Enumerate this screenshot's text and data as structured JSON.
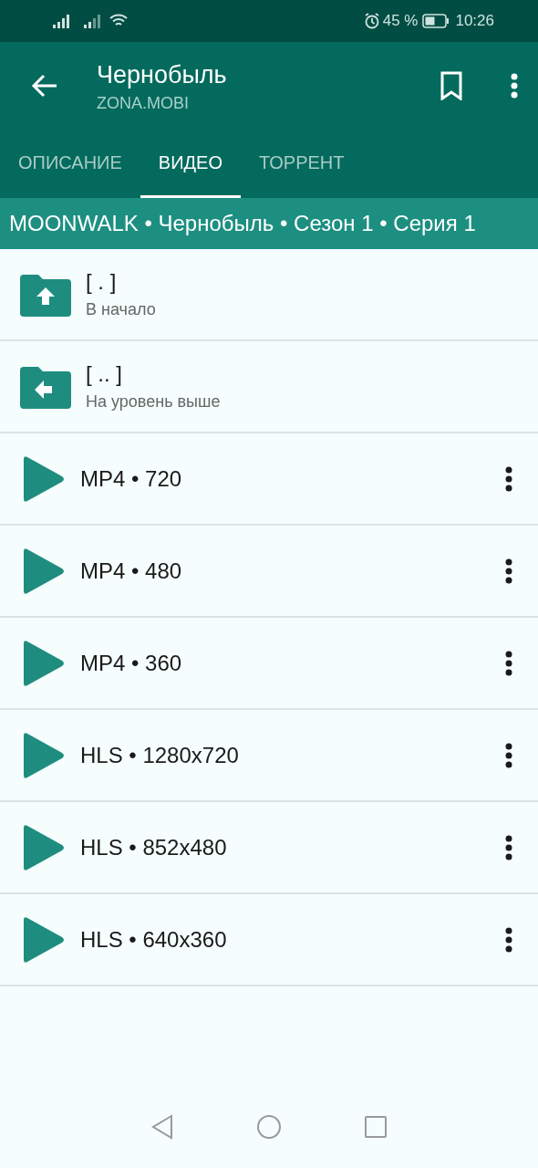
{
  "status_bar": {
    "battery": "45 %",
    "time": "10:26"
  },
  "app_bar": {
    "title": "Чернобыль",
    "subtitle": "ZONA.MOBI"
  },
  "tabs": [
    {
      "label": "ОПИСАНИЕ",
      "selected": false
    },
    {
      "label": "ВИДЕО",
      "selected": true
    },
    {
      "label": "ТОРРЕНТ",
      "selected": false
    }
  ],
  "breadcrumb": "MOONWALK • Чернобыль • Сезон 1 • Серия 1",
  "items": [
    {
      "kind": "folder_top",
      "title": "[ . ]",
      "subtitle": "В начало"
    },
    {
      "kind": "folder_up",
      "title": "[ .. ]",
      "subtitle": "На уровень выше"
    },
    {
      "kind": "video",
      "title": "MP4 • 720"
    },
    {
      "kind": "video",
      "title": "MP4 • 480"
    },
    {
      "kind": "video",
      "title": "MP4 • 360"
    },
    {
      "kind": "video",
      "title": "HLS • 1280x720"
    },
    {
      "kind": "video",
      "title": "HLS • 852x480"
    },
    {
      "kind": "video",
      "title": "HLS • 640x360"
    }
  ]
}
